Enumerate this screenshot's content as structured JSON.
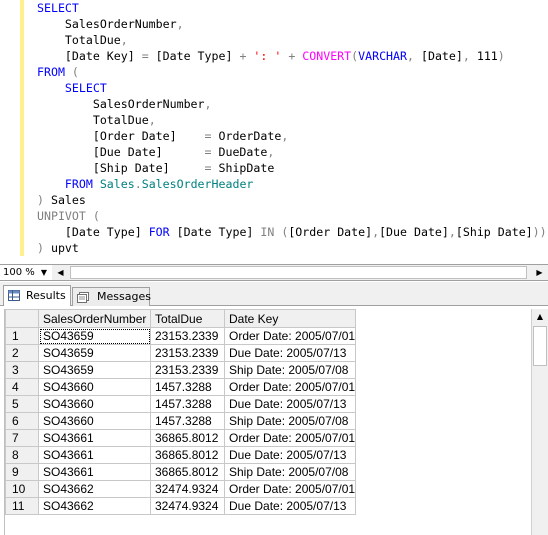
{
  "editor": {
    "lines": [
      [
        [
          "kw",
          "SELECT"
        ]
      ],
      [
        [
          "",
          "    SalesOrderNumber"
        ],
        [
          "gr",
          ","
        ]
      ],
      [
        [
          "",
          "    TotalDue"
        ],
        [
          "gr",
          ","
        ]
      ],
      [
        [
          "",
          "    [Date Key] "
        ],
        [
          "gr",
          "="
        ],
        [
          "",
          " [Date Type] "
        ],
        [
          "gr",
          "+"
        ],
        [
          "",
          " "
        ],
        [
          "rd",
          "': '"
        ],
        [
          "",
          " "
        ],
        [
          "gr",
          "+"
        ],
        [
          "",
          " "
        ],
        [
          "pk",
          "CONVERT"
        ],
        [
          "gr",
          "("
        ],
        [
          "kw",
          "VARCHAR"
        ],
        [
          "gr",
          ","
        ],
        [
          "",
          " [Date]"
        ],
        [
          "gr",
          ","
        ],
        [
          "",
          " 111"
        ],
        [
          "gr",
          ")"
        ]
      ],
      [
        [
          "kw",
          "FROM"
        ],
        [
          "",
          " "
        ],
        [
          "gr",
          "("
        ]
      ],
      [
        [
          "",
          "    "
        ],
        [
          "kw",
          "SELECT"
        ]
      ],
      [
        [
          "",
          "        SalesOrderNumber"
        ],
        [
          "gr",
          ","
        ]
      ],
      [
        [
          "",
          "        TotalDue"
        ],
        [
          "gr",
          ","
        ]
      ],
      [
        [
          "",
          "        [Order Date]    "
        ],
        [
          "gr",
          "="
        ],
        [
          "",
          " OrderDate"
        ],
        [
          "gr",
          ","
        ]
      ],
      [
        [
          "",
          "        [Due Date]      "
        ],
        [
          "gr",
          "="
        ],
        [
          "",
          " DueDate"
        ],
        [
          "gr",
          ","
        ]
      ],
      [
        [
          "",
          "        [Ship Date]     "
        ],
        [
          "gr",
          "="
        ],
        [
          "",
          " ShipDate"
        ]
      ],
      [
        [
          "",
          "    "
        ],
        [
          "kw",
          "FROM"
        ],
        [
          "",
          " "
        ],
        [
          "tl",
          "Sales"
        ],
        [
          "gr",
          "."
        ],
        [
          "tl",
          "SalesOrderHeader"
        ]
      ],
      [
        [
          "gr",
          ")"
        ],
        [
          "",
          " Sales"
        ]
      ],
      [
        [
          "gr",
          "UNPIVOT"
        ],
        [
          "",
          " "
        ],
        [
          "gr",
          "("
        ]
      ],
      [
        [
          "",
          "    [Date Type] "
        ],
        [
          "kw",
          "FOR"
        ],
        [
          "",
          " [Date Type] "
        ],
        [
          "gr",
          "IN"
        ],
        [
          "",
          " "
        ],
        [
          "gr",
          "("
        ],
        [
          "",
          "[Order Date]"
        ],
        [
          "gr",
          ","
        ],
        [
          "",
          "[Due Date]"
        ],
        [
          "gr",
          ","
        ],
        [
          "",
          "[Ship Date]"
        ],
        [
          "gr",
          "))"
        ]
      ],
      [
        [
          "gr",
          ")"
        ],
        [
          "",
          " upvt"
        ]
      ]
    ]
  },
  "statusbar": {
    "zoom": "100 %"
  },
  "tabs": {
    "results": "Results",
    "messages": "Messages"
  },
  "grid": {
    "columns": [
      "SalesOrderNumber",
      "TotalDue",
      "Date Key"
    ],
    "rows": [
      [
        "1",
        "SO43659",
        "23153.2339",
        "Order Date: 2005/07/01"
      ],
      [
        "2",
        "SO43659",
        "23153.2339",
        "Due Date: 2005/07/13"
      ],
      [
        "3",
        "SO43659",
        "23153.2339",
        "Ship Date: 2005/07/08"
      ],
      [
        "4",
        "SO43660",
        "1457.3288",
        "Order Date: 2005/07/01"
      ],
      [
        "5",
        "SO43660",
        "1457.3288",
        "Due Date: 2005/07/13"
      ],
      [
        "6",
        "SO43660",
        "1457.3288",
        "Ship Date: 2005/07/08"
      ],
      [
        "7",
        "SO43661",
        "36865.8012",
        "Order Date: 2005/07/01"
      ],
      [
        "8",
        "SO43661",
        "36865.8012",
        "Due Date: 2005/07/13"
      ],
      [
        "9",
        "SO43661",
        "36865.8012",
        "Ship Date: 2005/07/08"
      ],
      [
        "10",
        "SO43662",
        "32474.9324",
        "Order Date: 2005/07/01"
      ],
      [
        "11",
        "SO43662",
        "32474.9324",
        "Due Date: 2005/07/13"
      ]
    ]
  }
}
